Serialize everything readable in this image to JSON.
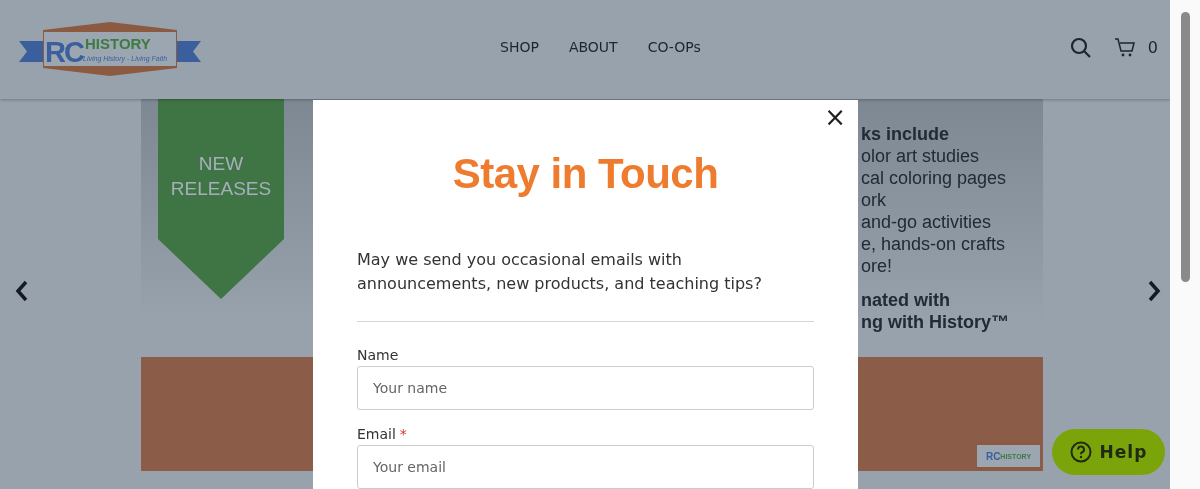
{
  "header": {
    "logo": {
      "initials": "RC",
      "wordmark": "HISTORY",
      "tagline": "Living History - Living Faith"
    },
    "nav": [
      {
        "label": "SHOP"
      },
      {
        "label": "ABOUT"
      },
      {
        "label": "CO-OPs"
      }
    ],
    "cart_count": "0"
  },
  "banner": {
    "ribbon": "NEW RELEASES",
    "lines": [
      {
        "text": "ks include",
        "kind": "bold"
      },
      {
        "text": "olor art studies",
        "kind": "regular"
      },
      {
        "text": "cal coloring pages",
        "kind": "regular"
      },
      {
        "text": "ork",
        "kind": "regular"
      },
      {
        "text": "and-go activities",
        "kind": "regular"
      },
      {
        "text": "e, hands-on crafts",
        "kind": "regular"
      },
      {
        "text": "ore!",
        "kind": "regular"
      },
      {
        "text": "nated with",
        "kind": "bold"
      },
      {
        "text": "ng with History™",
        "kind": "bold"
      }
    ],
    "corner_logo": {
      "initials": "RC",
      "wordmark": "HISTORY"
    }
  },
  "modal": {
    "close": "×",
    "title": "Stay in Touch",
    "message": "May we send you occasional emails with announcements, new products, and teaching tips?",
    "fields": [
      {
        "label": "Name",
        "placeholder": "Your name"
      },
      {
        "label": "Email",
        "required_mark": "*",
        "placeholder": "Your email"
      }
    ]
  },
  "help": {
    "label": "Help"
  }
}
